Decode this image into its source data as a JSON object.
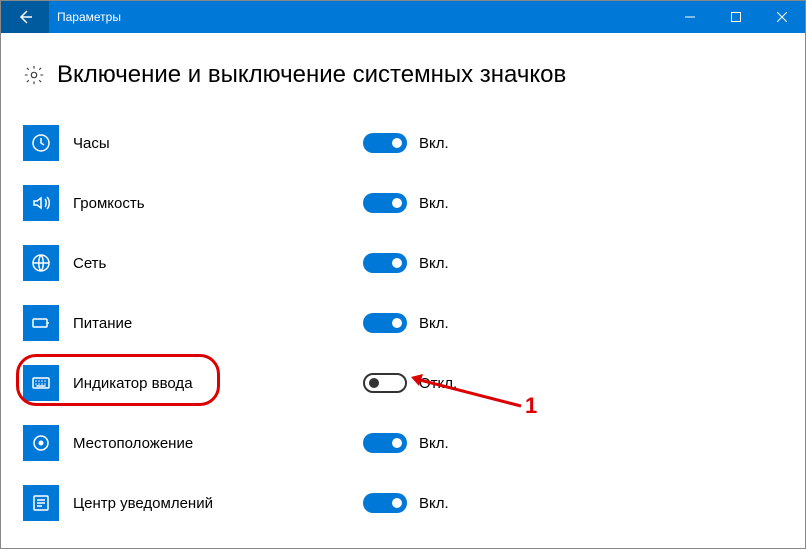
{
  "window": {
    "title": "Параметры"
  },
  "heading": "Включение и выключение системных значков",
  "state_labels": {
    "on": "Вкл.",
    "off": "Откл."
  },
  "items": [
    {
      "icon": "clock",
      "label": "Часы",
      "on": true
    },
    {
      "icon": "volume",
      "label": "Громкость",
      "on": true
    },
    {
      "icon": "globe",
      "label": "Сеть",
      "on": true
    },
    {
      "icon": "battery",
      "label": "Питание",
      "on": true
    },
    {
      "icon": "keyboard",
      "label": "Индикатор ввода",
      "on": false
    },
    {
      "icon": "location",
      "label": "Местоположение",
      "on": true
    },
    {
      "icon": "notify",
      "label": "Центр уведомлений",
      "on": true
    }
  ],
  "annotation": {
    "number": "1"
  }
}
